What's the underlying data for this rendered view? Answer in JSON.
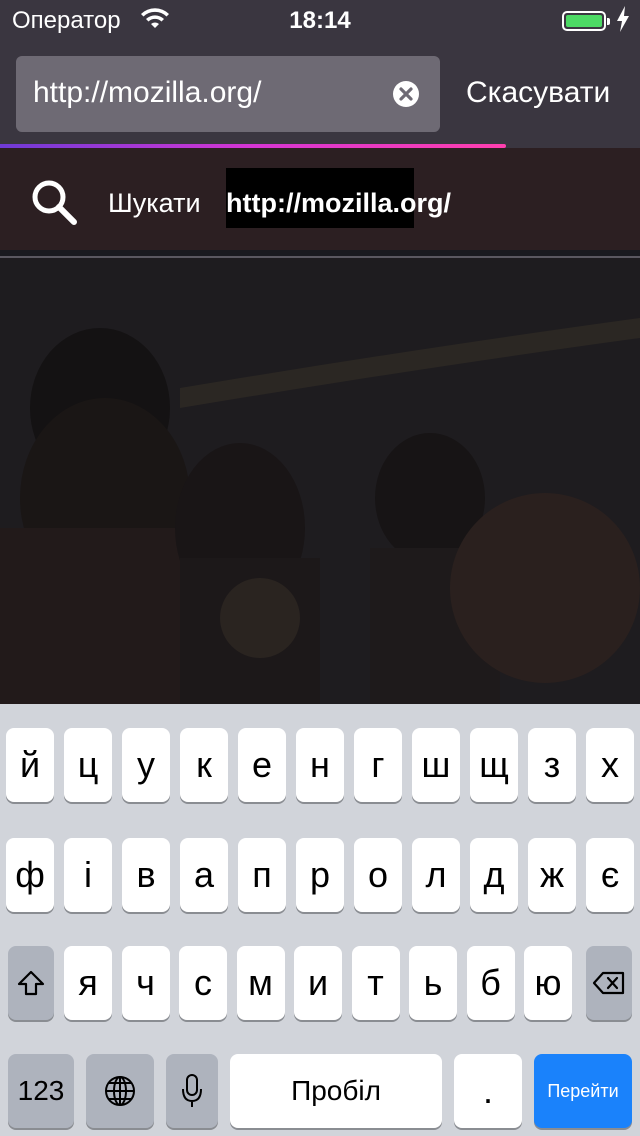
{
  "status_bar": {
    "carrier": "Оператор",
    "time": "18:14",
    "battery_level": 1.0
  },
  "url_bar": {
    "value": "http://mozilla.org/",
    "cancel_label": "Скасувати",
    "load_progress": 0.79
  },
  "suggestion": {
    "prefix": "Шукати",
    "query": "http://mozilla.org/"
  },
  "keyboard": {
    "row1": [
      "й",
      "ц",
      "у",
      "к",
      "е",
      "н",
      "г",
      "ш",
      "щ",
      "з",
      "х"
    ],
    "row2": [
      "ф",
      "і",
      "в",
      "а",
      "п",
      "р",
      "о",
      "л",
      "д",
      "ж",
      "є"
    ],
    "row3": [
      "я",
      "ч",
      "с",
      "м",
      "и",
      "т",
      "ь",
      "б",
      "ю"
    ],
    "numbers_label": "123",
    "space_label": "Пробіл",
    "period_label": ".",
    "go_label": "Перейти"
  },
  "colors": {
    "accent": "#1a82fb",
    "battery": "#4cd964"
  }
}
